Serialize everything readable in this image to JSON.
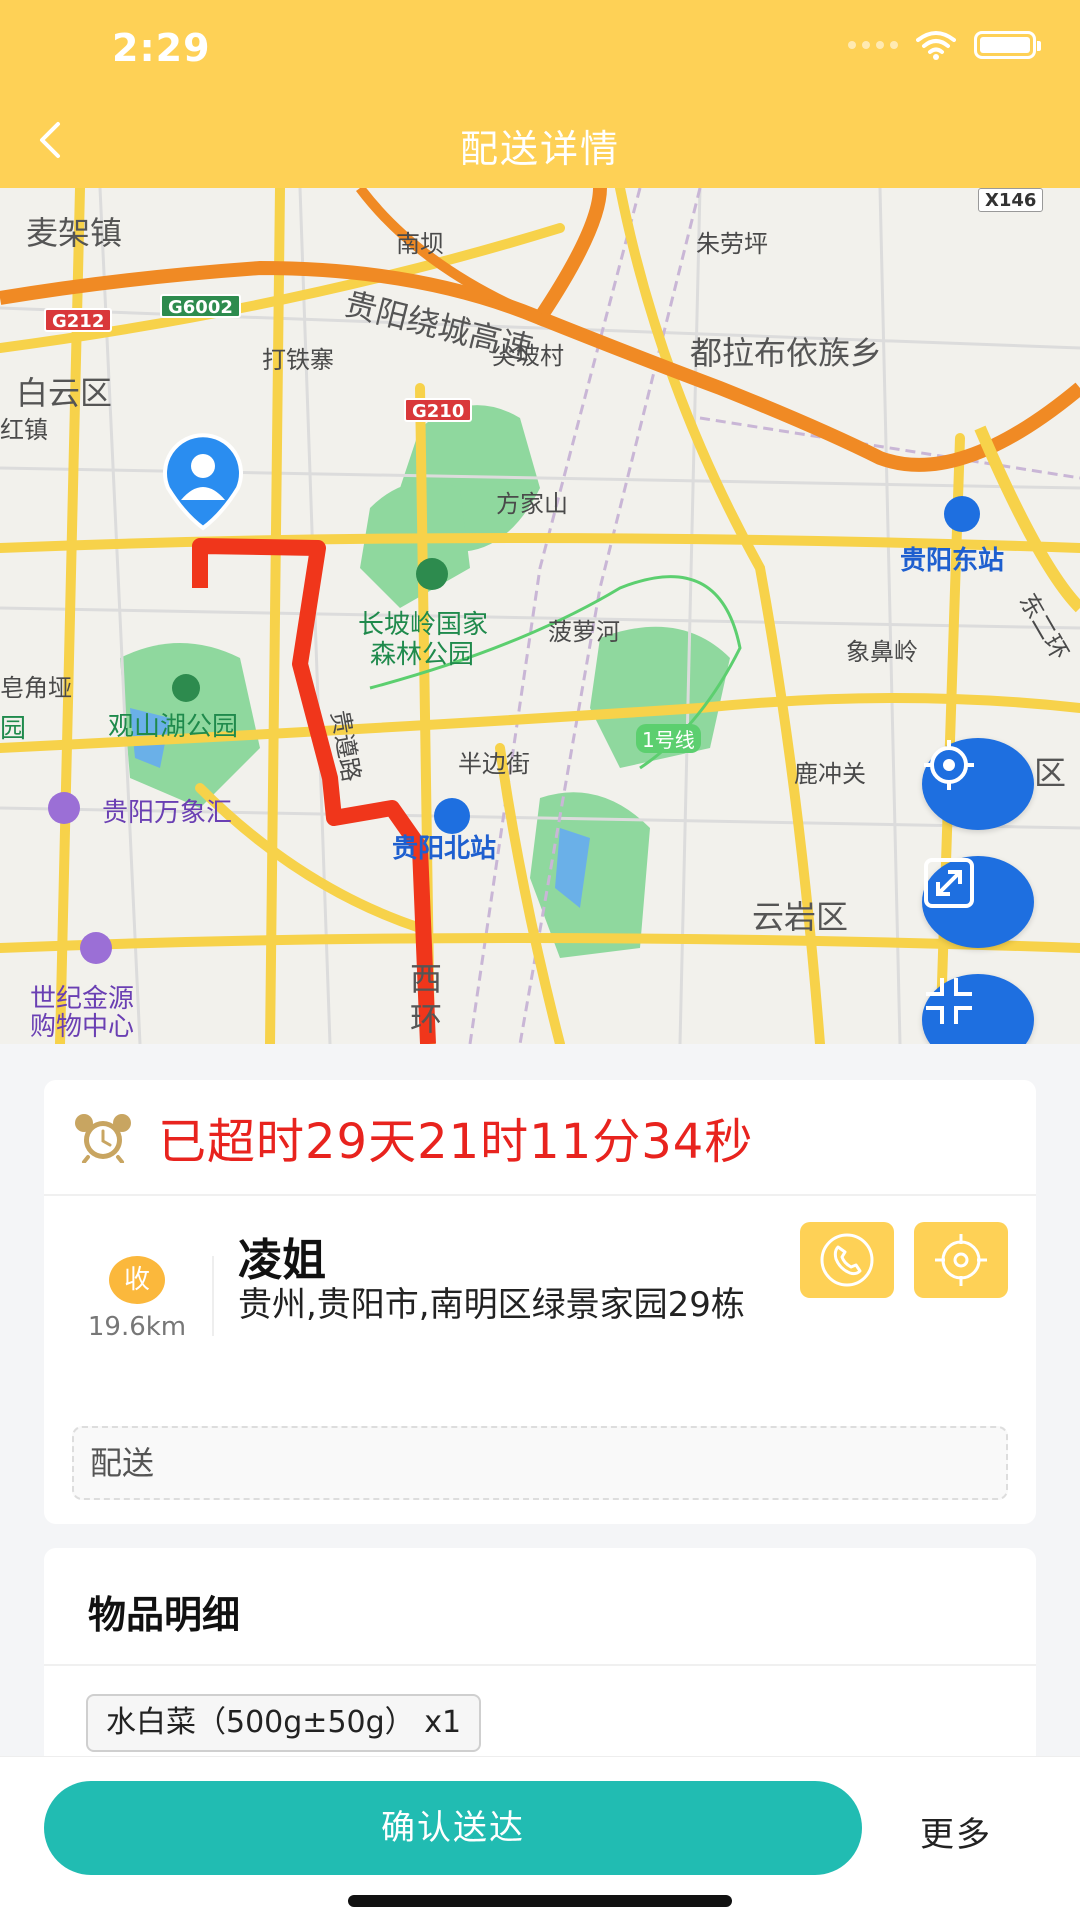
{
  "status_bar": {
    "time": "2:29"
  },
  "header": {
    "title": "配送详情"
  },
  "map": {
    "labels": {
      "maijia": "麦架镇",
      "nanba": "南坝",
      "zhulaoping": "朱劳坪",
      "guiyang_ring": "贵阳绕城高速",
      "jianpo": "尖坡村",
      "dulabu": "都拉布依族乡",
      "baiyun": "白云区",
      "datiezhai": "打铁寨",
      "hongzhen": "红镇",
      "fangjiashan": "方家山",
      "dongzhan": "贵阳东站",
      "changpoling": "长坡岭国家",
      "forest_park": "森林公园",
      "boluohe": "菠萝河",
      "xiangbiling": "象鼻岭",
      "dongerhuan": "东二环",
      "gaojiaoya": "皂角垭",
      "yuan": "园",
      "guanshanhu": "观山湖公园",
      "guizun": "贵遵路",
      "banbianjie": "半边街",
      "line1": "1号线",
      "luchongguan": "鹿冲关",
      "qu": "区",
      "mixc": "贵阳万象汇",
      "beizhan": "贵阳北站",
      "yunyan": "云岩区",
      "shiji1": "世纪金源",
      "shiji2": "购物中心",
      "xi": "西",
      "xi2": "环"
    },
    "shields": {
      "g212": "G212",
      "g6002": "G6002",
      "g210": "G210",
      "x146": "X146"
    }
  },
  "order": {
    "timeout_text": "已超时29天21时11分34秒",
    "receiver_badge": "收",
    "distance": "19.6km",
    "receiver_name": "凌姐",
    "address": "贵州,贵阳市,南明区绿景家园29栋",
    "note": "配送"
  },
  "items": {
    "title": "物品明细",
    "list": [
      "水白菜（500g±50g） x1"
    ]
  },
  "actions": {
    "confirm": "确认送达",
    "more": "更多"
  },
  "colors": {
    "header": "#fed156",
    "confirm": "#21bcb2",
    "timeout": "#e8231e",
    "map_button": "#1e6fe0"
  }
}
